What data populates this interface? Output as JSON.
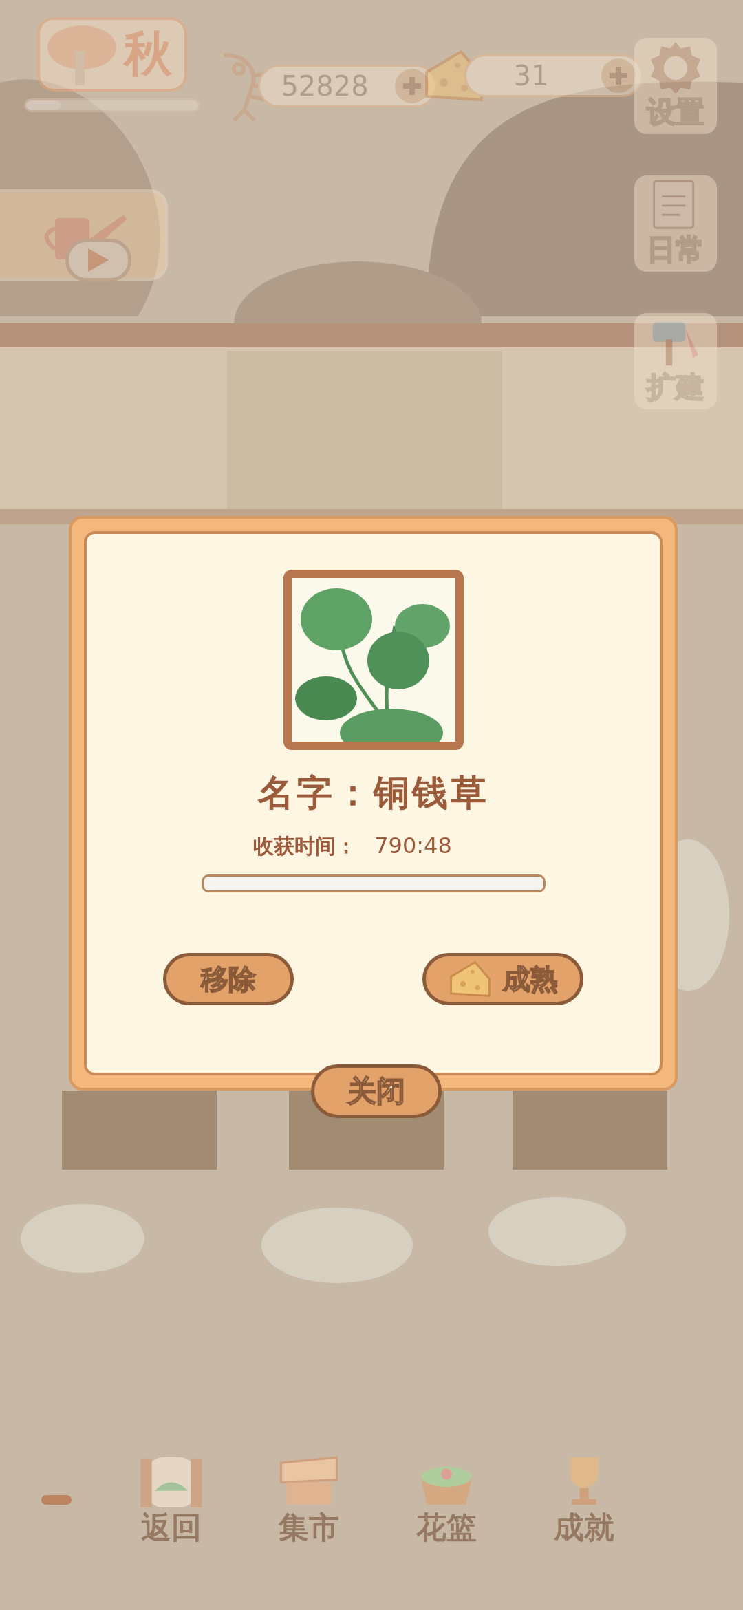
{
  "hud": {
    "season": {
      "label": "秋",
      "level": 0.2
    },
    "currencies": [
      {
        "kind": "fish",
        "amount": "52828"
      },
      {
        "kind": "cheese",
        "amount": "31"
      }
    ],
    "side_buttons": [
      {
        "kind": "settings",
        "label": "设置"
      },
      {
        "kind": "daily",
        "label": "日常"
      },
      {
        "kind": "expand",
        "label": "扩建"
      }
    ]
  },
  "dialog": {
    "name": "名字：铜钱草",
    "harvest_label": "收获时间：",
    "harvest_time": "790:48",
    "buttons": [
      {
        "kind": "remove",
        "label": "移除"
      },
      {
        "kind": "ripen",
        "label": "成熟"
      }
    ],
    "close": "关闭"
  },
  "bottom_nav": [
    {
      "kind": "back",
      "label": "返回"
    },
    {
      "kind": "market",
      "label": "集市"
    },
    {
      "kind": "basket",
      "label": "花篮"
    },
    {
      "kind": "achievement",
      "label": "成就"
    }
  ]
}
